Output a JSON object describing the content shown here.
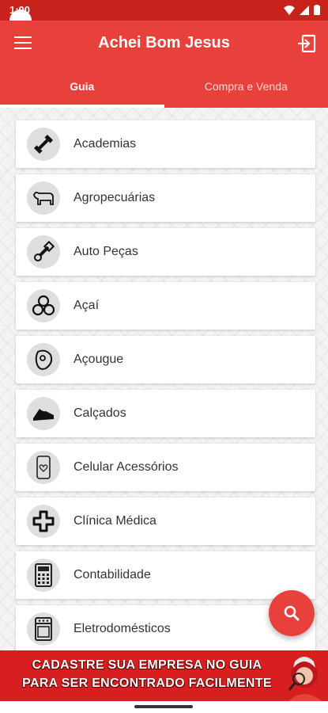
{
  "status": {
    "time": "1:00"
  },
  "app": {
    "title": "Achei Bom Jesus"
  },
  "tabs": [
    {
      "label": "Guia",
      "active": true
    },
    {
      "label": "Compra e Venda",
      "active": false
    }
  ],
  "categories": [
    {
      "label": "Academias",
      "icon": "dumbbell-icon"
    },
    {
      "label": "Agropecuárias",
      "icon": "cow-icon"
    },
    {
      "label": "Auto Peças",
      "icon": "car-part-icon"
    },
    {
      "label": "Açaí",
      "icon": "acai-berries-icon"
    },
    {
      "label": "Açougue",
      "icon": "meat-icon"
    },
    {
      "label": "Calçados",
      "icon": "shoe-icon"
    },
    {
      "label": "Celular Acessórios",
      "icon": "phone-icon"
    },
    {
      "label": "Clínica Médica",
      "icon": "medical-cross-icon"
    },
    {
      "label": "Contabilidade",
      "icon": "calculator-icon"
    },
    {
      "label": "Eletrodomésticos",
      "icon": "stove-icon"
    }
  ],
  "banner": {
    "line1": "CADASTRE SUA EMPRESA NO GUIA",
    "line2": "PARA SER ENCONTRADO FACILMENTE"
  },
  "colors": {
    "primary": "#e8403a",
    "status": "#c8221c",
    "banner": "#d81f1f"
  }
}
